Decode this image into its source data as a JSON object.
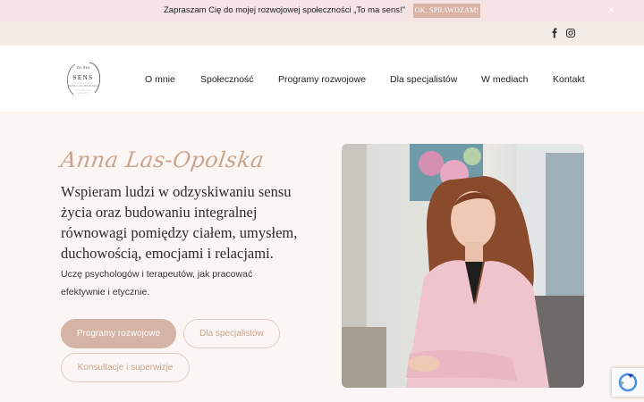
{
  "notice": {
    "text": "Zapraszam Cię do mojej rozwojowej społeczności „To ma sens!\"",
    "button_label": "OK, SPRAWDZAM!",
    "close_label": "×"
  },
  "social": {
    "icons": [
      "facebook-icon",
      "instagram-icon"
    ]
  },
  "header": {
    "logo_text": "SENS",
    "nav": [
      "O mnie",
      "Społeczność",
      "Programy rozwojowe",
      "Dla specjalistów",
      "W mediach",
      "Kontakt"
    ]
  },
  "hero": {
    "name": "Anna Las-Opolska",
    "headline": "Wspieram ludzi w odzyskiwaniu sensu życia oraz budowaniu integralnej równowagi pomiędzy ciałem, umysłem, duchowością, emocjami i relacjami.",
    "subtext": "Uczę psychologów i terapeutów, jak pracować efektywnie i etycznie.",
    "buttons": {
      "primary": "Programy rozwojowe",
      "specialists": "Dla specjalistów",
      "consult": "Konsultacje i superwizje"
    }
  },
  "colors": {
    "accent": "#d5b4a5",
    "script": "#c9a48f",
    "notice_bg": "#f6e3e6",
    "page_bg": "#fbf6f3"
  }
}
